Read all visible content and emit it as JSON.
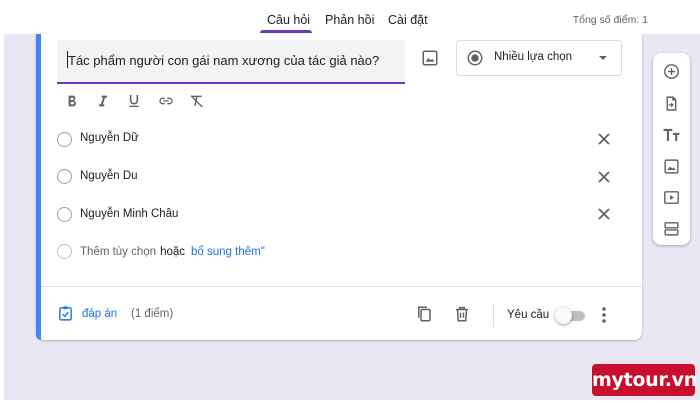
{
  "tabs": [
    {
      "label": "Câu hỏi",
      "active": true
    },
    {
      "label": "Phản hồi",
      "active": false
    },
    {
      "label": "Cài đặt",
      "active": false
    }
  ],
  "total_points": "Tổng số điểm: 1",
  "question": {
    "title": "Tác phẩm người con gái nam xương của tác giả nào?",
    "type": "Nhiều lựa chọn"
  },
  "format_toolbar": [
    "bold-icon",
    "italic-icon",
    "underline-icon",
    "link-icon",
    "clear-format-icon"
  ],
  "options": [
    {
      "label": "Nguyễn Dữ"
    },
    {
      "label": "Nguyễn Du"
    },
    {
      "label": "Nguyễn Minh Châu"
    }
  ],
  "add_option": {
    "placeholder": "Thêm tùy chọn",
    "or": "hoặc",
    "link": "bổ sung thêm\""
  },
  "footer": {
    "answer_label": "đáp án",
    "points": "(1 điểm)",
    "required_label": "Yêu cầu",
    "required_on": false
  },
  "sidebar_icons": [
    "add-question-icon",
    "import-icon",
    "add-title-icon",
    "add-image-icon",
    "add-video-icon",
    "add-section-icon"
  ],
  "watermark": "mytour.vn",
  "colors": {
    "accent": "#673ab7",
    "link": "#1a73e8",
    "active_card_bar": "#4285f4",
    "canvas": "#ebe6f4",
    "watermark_bg": "#c8102e"
  }
}
